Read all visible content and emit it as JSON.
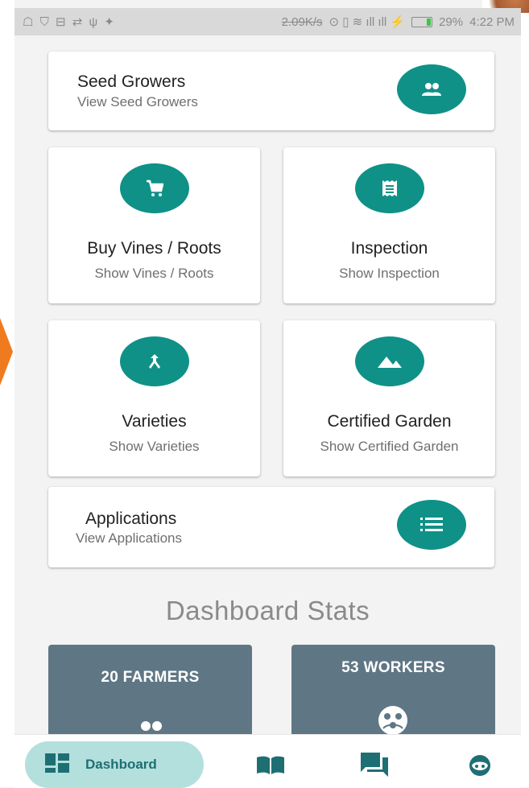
{
  "statusbar": {
    "left_icons": "☖ ⛉ ⊟ ⇄ ψ ✦",
    "speed": "2.09K/s",
    "battery": "29%",
    "time": "4:22 PM"
  },
  "cards": {
    "seed_growers": {
      "title": "Seed Growers",
      "subtitle": "View Seed Growers",
      "icon": "people-icon"
    },
    "buy_vines": {
      "title": "Buy Vines / Roots",
      "subtitle": "Show Vines / Roots",
      "icon": "cart-icon"
    },
    "inspection": {
      "title": "Inspection",
      "subtitle": "Show Inspection",
      "icon": "receipt-icon"
    },
    "varieties": {
      "title": "Varieties",
      "subtitle": "Show Varieties",
      "icon": "merge-icon"
    },
    "certified_garden": {
      "title": "Certified Garden",
      "subtitle": "Show Certified Garden",
      "icon": "landscape-icon"
    },
    "applications": {
      "title": "Applications",
      "subtitle": "View Applications",
      "icon": "list-icon"
    }
  },
  "stats": {
    "title": "Dashboard Stats",
    "farmers": "20 FARMERS",
    "workers": "53 WORKERS"
  },
  "nav": {
    "dashboard_label": "Dashboard",
    "items": [
      "dashboard-icon",
      "book-icon",
      "chat-icon",
      "face-icon"
    ]
  },
  "colors": {
    "accent": "#0f9187",
    "stat_card": "#5f7785",
    "nav_pill": "#b3e0dd",
    "nav_text": "#1e6f73",
    "background": "#f3f3f3"
  }
}
